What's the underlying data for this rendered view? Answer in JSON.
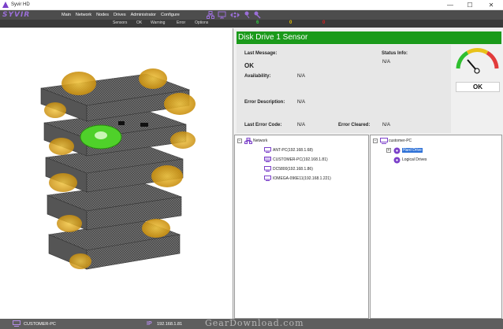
{
  "window": {
    "title": "Syvir HD",
    "minimize": "—",
    "maximize": "☐",
    "close": "✕"
  },
  "menubar": {
    "logo": "SYVIR",
    "items": [
      "Main",
      "Network",
      "Nodes",
      "Drives",
      "Administrator",
      "Configure"
    ]
  },
  "subbar": {
    "items": [
      "Sensors",
      "OK",
      "Warning",
      "Error",
      "Options"
    ],
    "ok_count": "6",
    "warning_count": "0",
    "error_count": "0"
  },
  "sensor": {
    "title": "Disk Drive 1 Sensor",
    "last_message_label": "Last Message:",
    "last_message_value": "OK",
    "status_info_label": "Status Info:",
    "status_info_value": "N/A",
    "availability_label": "Availability:",
    "availability_value": "N/A",
    "error_description_label": "Error Description:",
    "error_description_value": "N/A",
    "last_error_code_label": "Last Error Code:",
    "last_error_code_value": "N/A",
    "error_cleared_label": "Error Cleared:",
    "error_cleared_value": "N/A",
    "gauge_status": "OK"
  },
  "network_tree": {
    "root": "Network",
    "nodes": [
      "ANT-PC(192.168.1.68)",
      "CUSTOMER-PC(192.168.1.81)",
      "DC5800(192.168.1.86)",
      "IOMEGA-096E11(192.168.1.221)"
    ]
  },
  "drive_tree": {
    "root": "customer-PC",
    "items": [
      "Hard Drive",
      "Logical Drives"
    ]
  },
  "statusbar": {
    "computer": "CUSTOMER-PC",
    "ip_label": "IP",
    "ip": "192.168.1.81",
    "watermark": "GearDownload.com"
  },
  "colors": {
    "sensor_header": "#1b9a1b",
    "menubar": "#4d4d4d",
    "ok_count": "#2ecc40",
    "warning_count": "#e6c200",
    "error_count": "#e02020",
    "accent_purple": "#7a3fc9"
  }
}
